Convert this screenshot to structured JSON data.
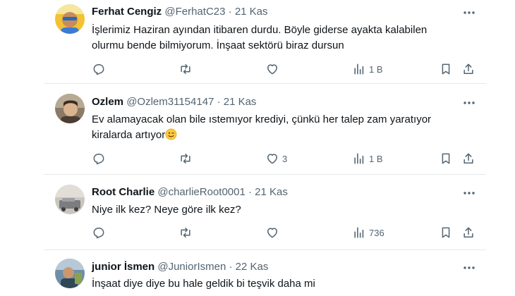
{
  "posts": [
    {
      "name": "Ferhat Cengiz",
      "handle": "@FerhatC23",
      "separator": "·",
      "date": "21 Kas",
      "text_lines": [
        "İşlerimiz Haziran ayından itibaren durdu. Böyle giderse ayakta kalabilen",
        "olurmu bende bilmiyorum. İnşaat sektörü biraz dursun"
      ],
      "likes": "",
      "views": "1 B"
    },
    {
      "name": "Ozlem",
      "handle": "@Ozlem31154147",
      "separator": "·",
      "date": "21 Kas",
      "text_lines": [
        "Ev alamayacak olan bile ıstemıyor krediyi, çünkü her talep zam yaratıyor",
        "kiralarda artıyor"
      ],
      "likes": "3",
      "views": "1 B"
    },
    {
      "name": "Root Charlie",
      "handle": "@charlieRoot0001",
      "separator": "·",
      "date": "21 Kas",
      "text_lines": [
        "Niye ilk kez? Neye göre ilk kez?"
      ],
      "likes": "",
      "views": "736"
    },
    {
      "name": "junior İsmen",
      "handle": "@JuniorIsmen",
      "separator": "·",
      "date": "22 Kas",
      "text_lines": [
        "İnşaat diye diye bu hale geldik bi teşvik daha mi"
      ]
    }
  ],
  "icons": {
    "reply": "reply-icon",
    "repost": "repost-icon",
    "like": "heart-icon",
    "views": "views-icon",
    "bookmark": "bookmark-icon",
    "share": "share-icon",
    "more": "more-icon"
  },
  "colors": {
    "text": "#0f1419",
    "secondary": "#536471",
    "divider": "#e7e9ea"
  }
}
